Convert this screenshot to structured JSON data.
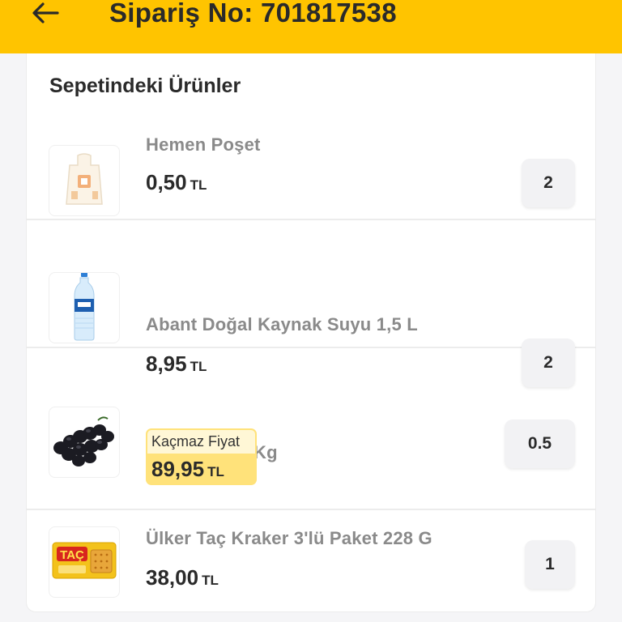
{
  "header": {
    "title": "Sipariş No: 701817538",
    "back_icon": "arrow-left-icon",
    "background": "#ffc400"
  },
  "cart": {
    "title": "Sepetindeki Ürünler",
    "items": [
      {
        "name": "Hemen Poşet",
        "price": "0,50",
        "currency": "TL",
        "quantity": "2",
        "image": "bag-icon"
      },
      {
        "name": "Abant Doğal Kaynak Suyu 1,5 L",
        "price": "8,95",
        "currency": "TL",
        "quantity": "2",
        "image": "water-bottle-icon"
      },
      {
        "name": "Üzüm Siyah Kg",
        "deal_label": "Kaçmaz Fiyat",
        "price": "89,95",
        "currency": "TL",
        "quantity": "0.5",
        "image": "grapes-icon"
      },
      {
        "name": "Ülker Taç Kraker 3'lü Paket 228 G",
        "price": "38,00",
        "currency": "TL",
        "quantity": "1",
        "image": "cracker-pack-icon",
        "image_text": "TAÇ"
      }
    ]
  }
}
